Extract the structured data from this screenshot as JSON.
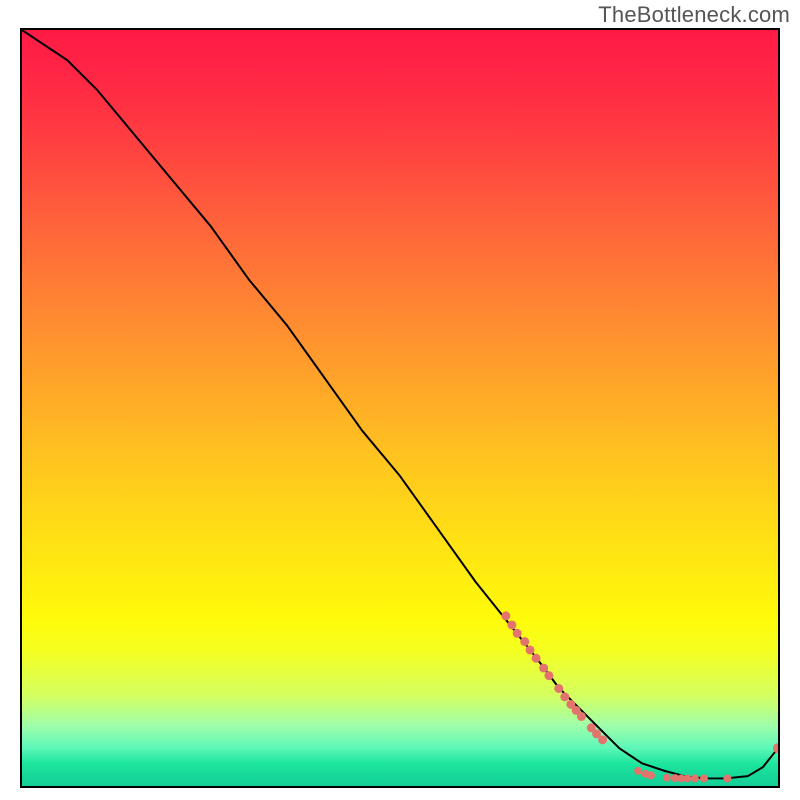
{
  "watermark": "TheBottleneck.com",
  "chart_data": {
    "type": "line",
    "title": "",
    "xlabel": "",
    "ylabel": "",
    "xlim": [
      0,
      100
    ],
    "ylim": [
      0,
      100
    ],
    "background_gradient": {
      "top": "#ff1a46",
      "mid": "#ffd818",
      "bottom": "#15d098"
    },
    "series": [
      {
        "name": "curve",
        "x": [
          0,
          6,
          10,
          15,
          20,
          25,
          30,
          35,
          40,
          45,
          50,
          55,
          60,
          64,
          68,
          71,
          74,
          76,
          79,
          82,
          85,
          88,
          91,
          93,
          96,
          98,
          100
        ],
        "y": [
          100,
          96,
          92,
          86,
          80,
          74,
          67,
          61,
          54,
          47,
          41,
          34,
          27,
          22,
          17,
          13,
          10,
          8,
          5,
          3,
          2,
          1.2,
          1,
          1,
          1.3,
          2.5,
          5
        ]
      }
    ],
    "scatter": [
      {
        "name": "dots-descent",
        "size": 9,
        "color": "#e2736d",
        "points": [
          {
            "x": 64,
            "y": 22.5
          },
          {
            "x": 64.8,
            "y": 21.3
          },
          {
            "x": 65.5,
            "y": 20.2
          },
          {
            "x": 66.5,
            "y": 19.1
          },
          {
            "x": 67.2,
            "y": 18.0
          },
          {
            "x": 68.0,
            "y": 16.9
          },
          {
            "x": 69.0,
            "y": 15.6
          },
          {
            "x": 69.7,
            "y": 14.6
          },
          {
            "x": 71.0,
            "y": 12.9
          },
          {
            "x": 71.8,
            "y": 11.8
          },
          {
            "x": 72.6,
            "y": 10.8
          },
          {
            "x": 73.3,
            "y": 10.0
          },
          {
            "x": 74.0,
            "y": 9.2
          },
          {
            "x": 75.3,
            "y": 7.7
          },
          {
            "x": 76.0,
            "y": 6.9
          },
          {
            "x": 76.8,
            "y": 6.1
          }
        ]
      },
      {
        "name": "dots-trough",
        "size": 8,
        "color": "#e2736d",
        "points": [
          {
            "x": 81.5,
            "y": 2.0
          },
          {
            "x": 82.5,
            "y": 1.6
          },
          {
            "x": 83.2,
            "y": 1.4
          },
          {
            "x": 85.3,
            "y": 1.1
          },
          {
            "x": 86.4,
            "y": 1.05
          },
          {
            "x": 87.2,
            "y": 1.0
          },
          {
            "x": 88.0,
            "y": 1.0
          },
          {
            "x": 89.0,
            "y": 1.0
          },
          {
            "x": 90.2,
            "y": 1.0
          },
          {
            "x": 93.3,
            "y": 1.0
          }
        ]
      },
      {
        "name": "dot-end",
        "size": 10,
        "color": "#e2736d",
        "points": [
          {
            "x": 100,
            "y": 5.0
          }
        ]
      }
    ]
  }
}
